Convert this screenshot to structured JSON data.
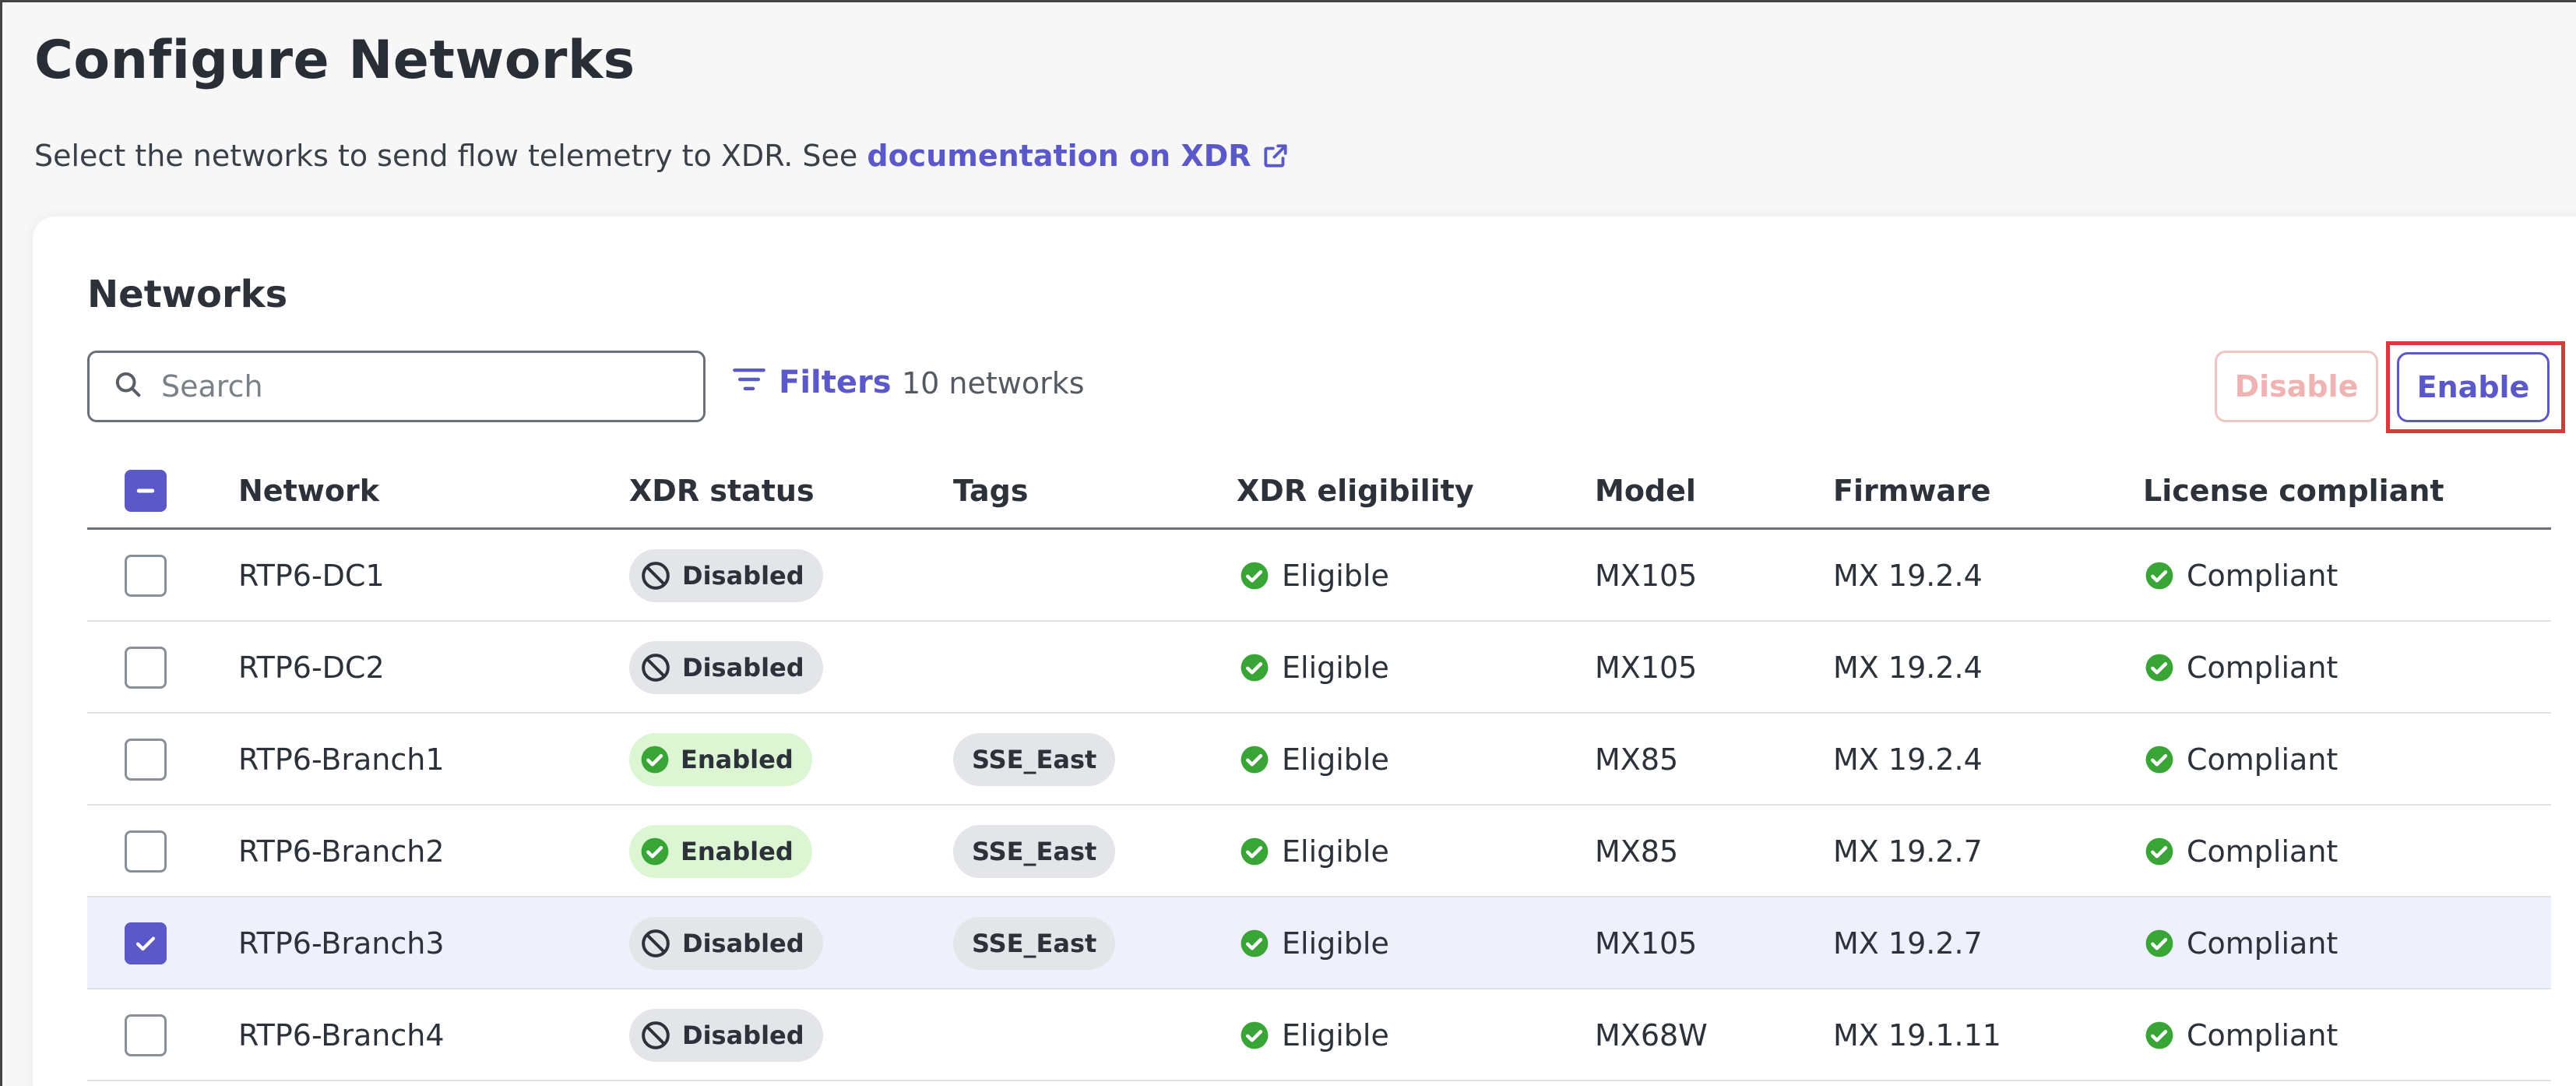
{
  "page": {
    "title": "Configure Networks",
    "subtitle_prefix": "Select the networks to send flow telemetry to XDR. See ",
    "doc_link": "documentation on XDR"
  },
  "section": {
    "title": "Networks",
    "search_placeholder": "Search",
    "filters_label": "Filters",
    "count_label": "10 networks",
    "disable_label": "Disable",
    "enable_label": "Enable"
  },
  "table": {
    "headers": {
      "network": "Network",
      "xdr_status": "XDR status",
      "tags": "Tags",
      "xdr_eligibility": "XDR eligibility",
      "model": "Model",
      "firmware": "Firmware",
      "license": "License compliant"
    },
    "rows": [
      {
        "network": "RTP6-DC1",
        "status": "Disabled",
        "tag": "",
        "eligibility": "Eligible",
        "model": "MX105",
        "firmware": "MX 19.2.4",
        "license": "Compliant"
      },
      {
        "network": "RTP6-DC2",
        "status": "Disabled",
        "tag": "",
        "eligibility": "Eligible",
        "model": "MX105",
        "firmware": "MX 19.2.4",
        "license": "Compliant"
      },
      {
        "network": "RTP6-Branch1",
        "status": "Enabled",
        "tag": "SSE_East",
        "eligibility": "Eligible",
        "model": "MX85",
        "firmware": "MX 19.2.4",
        "license": "Compliant"
      },
      {
        "network": "RTP6-Branch2",
        "status": "Enabled",
        "tag": "SSE_East",
        "eligibility": "Eligible",
        "model": "MX85",
        "firmware": "MX 19.2.7",
        "license": "Compliant"
      },
      {
        "network": "RTP6-Branch3",
        "status": "Disabled",
        "tag": "SSE_East",
        "eligibility": "Eligible",
        "model": "MX105",
        "firmware": "MX 19.2.7",
        "license": "Compliant"
      },
      {
        "network": "RTP6-Branch4",
        "status": "Disabled",
        "tag": "",
        "eligibility": "Eligible",
        "model": "MX68W",
        "firmware": "MX 19.1.11",
        "license": "Compliant"
      }
    ]
  },
  "colors": {
    "accent": "#5b58c9",
    "success": "#3aa537",
    "danger_outline": "#d63a3a"
  }
}
